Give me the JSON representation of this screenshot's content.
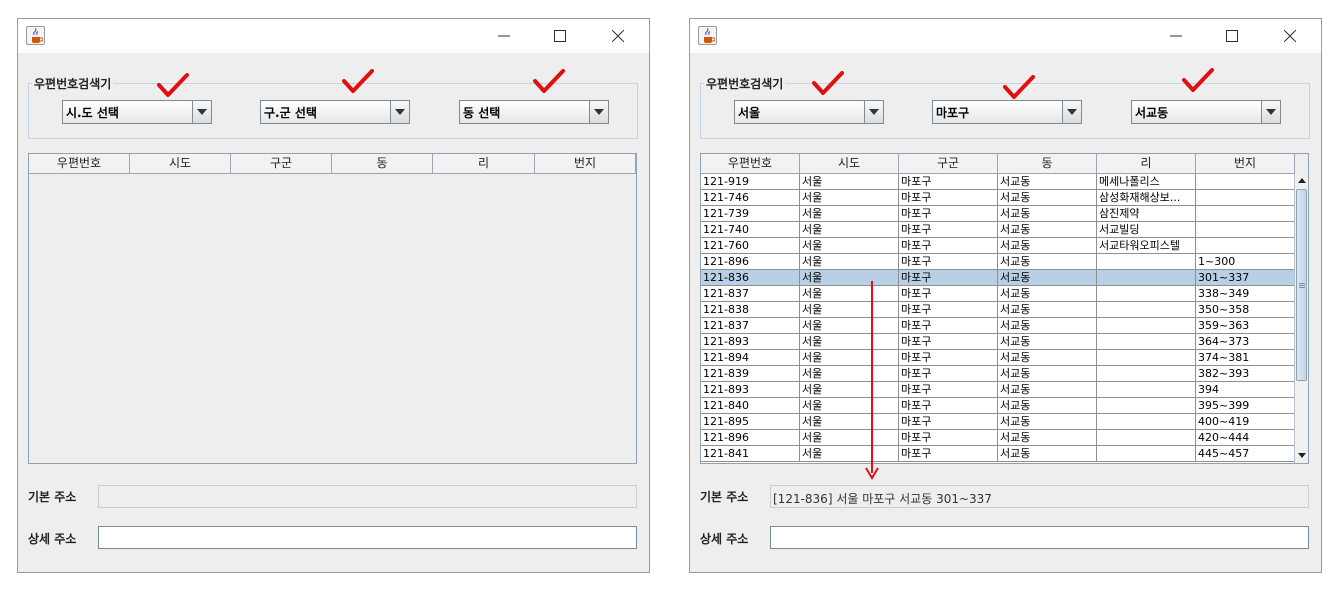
{
  "colors": {
    "annotation_red": "#e01010",
    "selected_row": "#b8cfe5",
    "window_bg": "#eeeeee"
  },
  "icons": {
    "app": "java-coffee-icon",
    "minimize": "minimize-icon",
    "maximize": "maximize-icon",
    "close": "close-icon",
    "check": "red-checkmark-icon"
  },
  "left": {
    "group_title": "우편번호검색기",
    "combo_sido": "시.도 선택",
    "combo_gugun": "구.군 선택",
    "combo_dong": "동 선택",
    "columns": [
      "우편번호",
      "시도",
      "구군",
      "동",
      "리",
      "번지"
    ],
    "basic_label": "기본 주소",
    "detail_label": "상세 주소",
    "basic_value": "",
    "detail_value": ""
  },
  "right": {
    "group_title": "우편번호검색기",
    "combo_sido": "서울",
    "combo_gugun": "마포구",
    "combo_dong": "서교동",
    "columns": [
      "우편번호",
      "시도",
      "구군",
      "동",
      "리",
      "번지"
    ],
    "selected_row": 6,
    "rows": [
      [
        "121-919",
        "서울",
        "마포구",
        "서교동",
        "메세나폴리스",
        ""
      ],
      [
        "121-746",
        "서울",
        "마포구",
        "서교동",
        "삼성화재해상보...",
        ""
      ],
      [
        "121-739",
        "서울",
        "마포구",
        "서교동",
        "삼진제약",
        ""
      ],
      [
        "121-740",
        "서울",
        "마포구",
        "서교동",
        "서교빌딩",
        ""
      ],
      [
        "121-760",
        "서울",
        "마포구",
        "서교동",
        "서교타워오피스텔",
        ""
      ],
      [
        "121-896",
        "서울",
        "마포구",
        "서교동",
        "",
        "1~300"
      ],
      [
        "121-836",
        "서울",
        "마포구",
        "서교동",
        "",
        "301~337"
      ],
      [
        "121-837",
        "서울",
        "마포구",
        "서교동",
        "",
        "338~349"
      ],
      [
        "121-838",
        "서울",
        "마포구",
        "서교동",
        "",
        "350~358"
      ],
      [
        "121-837",
        "서울",
        "마포구",
        "서교동",
        "",
        "359~363"
      ],
      [
        "121-893",
        "서울",
        "마포구",
        "서교동",
        "",
        "364~373"
      ],
      [
        "121-894",
        "서울",
        "마포구",
        "서교동",
        "",
        "374~381"
      ],
      [
        "121-839",
        "서울",
        "마포구",
        "서교동",
        "",
        "382~393"
      ],
      [
        "121-893",
        "서울",
        "마포구",
        "서교동",
        "",
        "394"
      ],
      [
        "121-840",
        "서울",
        "마포구",
        "서교동",
        "",
        "395~399"
      ],
      [
        "121-895",
        "서울",
        "마포구",
        "서교동",
        "",
        "400~419"
      ],
      [
        "121-896",
        "서울",
        "마포구",
        "서교동",
        "",
        "420~444"
      ],
      [
        "121-841",
        "서울",
        "마포구",
        "서교동",
        "",
        "445~457"
      ]
    ],
    "basic_label": "기본 주소",
    "detail_label": "상세 주소",
    "basic_value": "[121-836] 서울 마포구 서교동  301~337",
    "detail_value": ""
  }
}
